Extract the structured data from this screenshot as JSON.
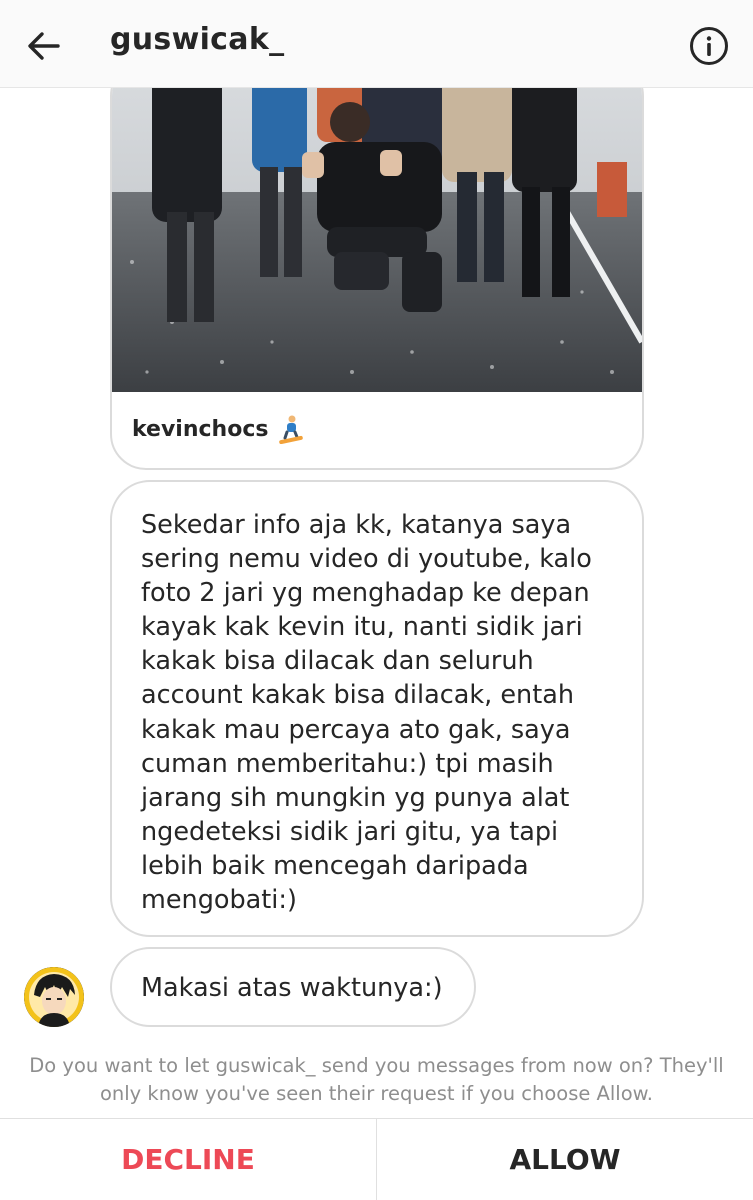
{
  "header": {
    "username": "guswicak_",
    "back_icon": "arrow-left-icon",
    "info_icon": "info-circle-icon"
  },
  "shared_post": {
    "author": "kevinchocs",
    "emoji_icon": "snowboarder-icon"
  },
  "messages": [
    {
      "text": "Sekedar info aja kk, katanya saya\nsering nemu video di youtube, kalo\nfoto 2 jari yg menghadap ke depan\nkayak kak kevin itu, nanti sidik jari\nkakak bisa dilacak dan seluruh\naccount kakak bisa dilacak, entah\nkakak mau percaya ato gak, saya\ncuman memberitahu:) tpi masih\njarang sih mungkin yg punya alat\nngedeteksi sidik jari gitu, ya tapi\nlebih baik mencegah daripada\nmengobati:)"
    },
    {
      "text": "Makasi atas waktunya:)"
    }
  ],
  "request": {
    "prompt": "Do you want to let guswicak_ send you messages from now on? They'll only know you've seen their request if you choose Allow.",
    "decline_label": "DECLINE",
    "allow_label": "ALLOW"
  },
  "colors": {
    "decline": "#ed4956",
    "text": "#262626",
    "muted": "#8e8e8e",
    "border": "#dbdbdb"
  }
}
